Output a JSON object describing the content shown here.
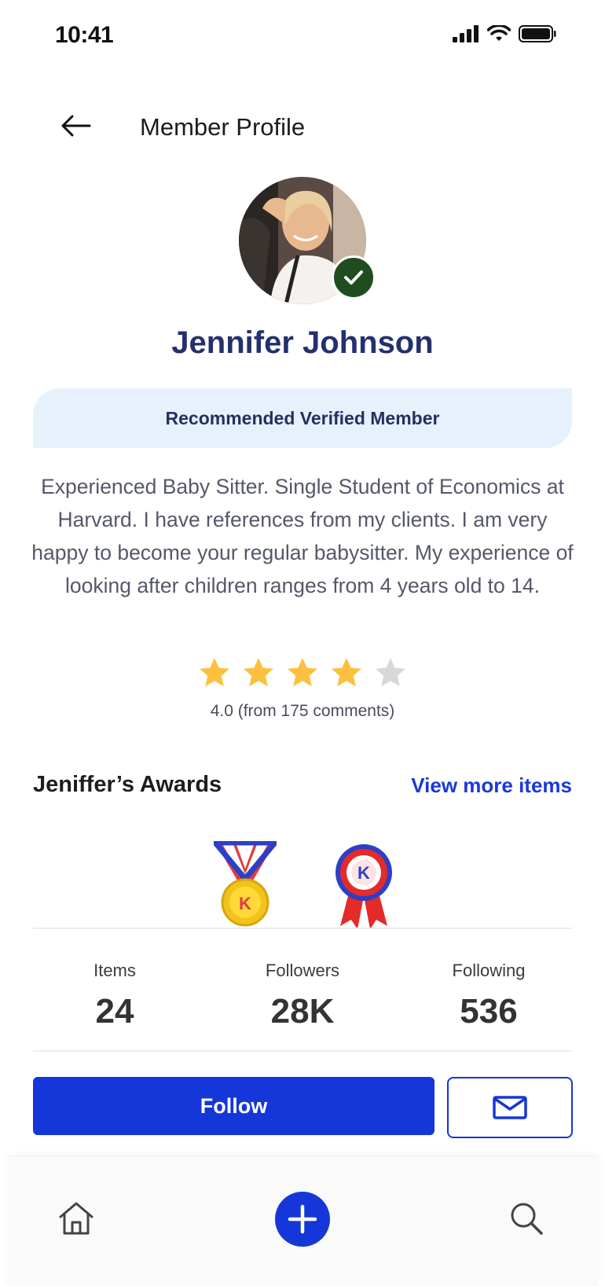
{
  "status_bar": {
    "time": "10:41"
  },
  "header": {
    "title": "Member Profile"
  },
  "profile": {
    "name": "Jennifer Johnson",
    "badge": "Recommended Verified Member",
    "bio": "Experienced Baby Sitter. Single Student  of Economics at Harvard. I have references from my clients. I am very happy to become your regular babysitter. My experience of looking after children ranges from 4 years old to 14.",
    "rating": {
      "value": 4,
      "max": 5,
      "text": "4.0 (from 175 comments)"
    }
  },
  "awards": {
    "title": "Jeniffer’s Awards",
    "view_more": "View more items",
    "items": [
      {
        "icon": "gold-medal-icon",
        "letter": "K"
      },
      {
        "icon": "rosette-icon",
        "letter": "K"
      }
    ]
  },
  "stats": [
    {
      "label": "Items",
      "value": "24"
    },
    {
      "label": "Followers",
      "value": "28K"
    },
    {
      "label": "Following",
      "value": "536"
    }
  ],
  "actions": {
    "follow": "Follow"
  },
  "colors": {
    "primary": "#1537d9",
    "name": "#24306e",
    "badge_bg": "#e6f1fc",
    "star": "#fbc13e",
    "star_empty": "#d8d8d8",
    "verified": "#1f4d1f"
  }
}
